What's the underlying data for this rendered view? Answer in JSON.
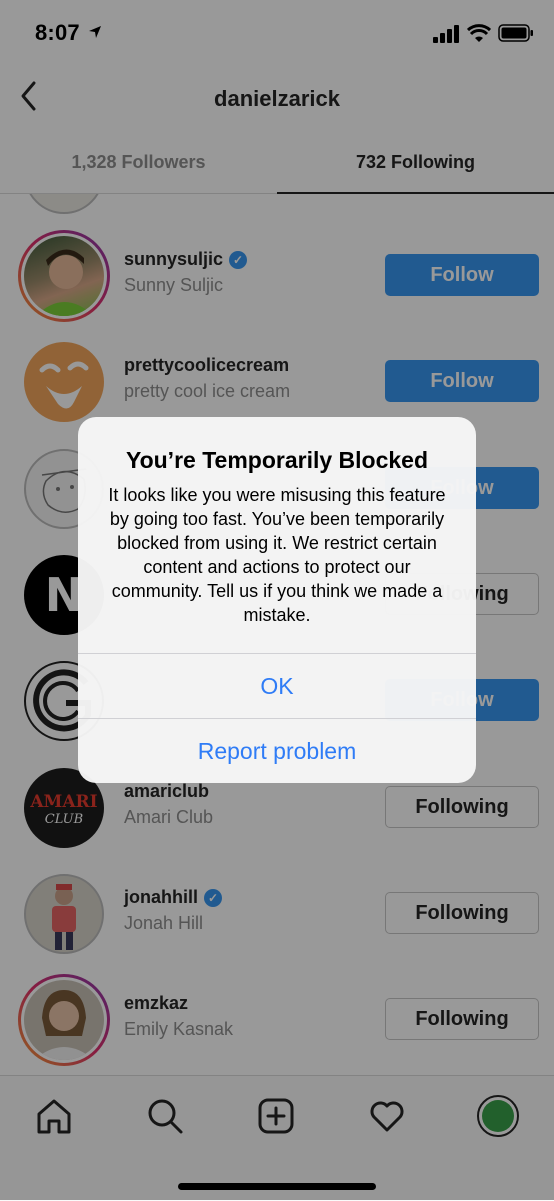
{
  "status_bar": {
    "time": "8:07"
  },
  "header": {
    "title": "danielzarick"
  },
  "tabs": [
    {
      "label": "1,328 Followers"
    },
    {
      "label": "732 Following"
    }
  ],
  "rows": [
    {
      "username": "sunnysuljic",
      "full_name": "Sunny Suljic",
      "verified": true,
      "button": "Follow"
    },
    {
      "username": "prettycoolicecream",
      "full_name": "pretty cool ice cream",
      "verified": false,
      "button": "Follow"
    },
    {
      "username": "",
      "full_name": "",
      "verified": false,
      "button": "Follow"
    },
    {
      "username": "",
      "full_name": "",
      "verified": false,
      "button": "Following"
    },
    {
      "username": "",
      "full_name": "",
      "verified": false,
      "button": "Follow"
    },
    {
      "username": "amariclub",
      "full_name": "Amari Club",
      "verified": false,
      "button": "Following"
    },
    {
      "username": "jonahhill",
      "full_name": "Jonah Hill",
      "verified": true,
      "button": "Following"
    },
    {
      "username": "emzkaz",
      "full_name": "Emily Kasnak",
      "verified": false,
      "button": "Following"
    }
  ],
  "avatar_text": {
    "n_logo": "N",
    "amari_top": "AMARI",
    "amari_bottom": "CLUB"
  },
  "alert": {
    "title": "You’re Temporarily Blocked",
    "message": "It looks like you were misusing this feature by going too fast. You’ve been temporarily blocked from using it. We restrict certain content and actions to protect our community. Tell us if you think we made a mistake.",
    "ok_label": "OK",
    "report_label": "Report problem"
  },
  "nav": {
    "icons": [
      "home-icon",
      "search-icon",
      "add-post-icon",
      "heart-icon",
      "profile-avatar"
    ]
  },
  "colors": {
    "accent": "#3897f0",
    "alert_button": "#2f7cf6",
    "profile_green": "#3aa14a"
  }
}
